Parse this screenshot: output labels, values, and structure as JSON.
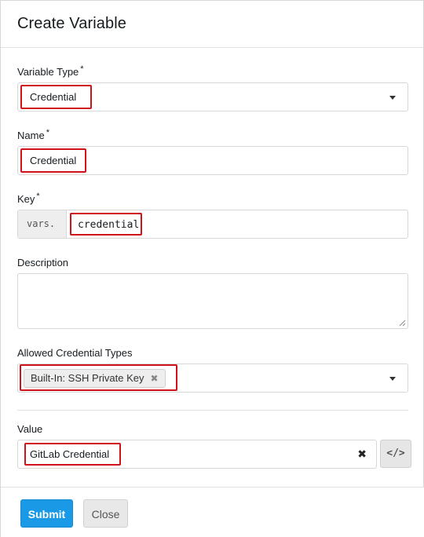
{
  "modal": {
    "title": "Create Variable"
  },
  "form": {
    "variable_type": {
      "label": "Variable Type",
      "required_mark": "*",
      "selected": "Credential"
    },
    "name": {
      "label": "Name",
      "required_mark": "*",
      "value": "Credential"
    },
    "key": {
      "label": "Key",
      "required_mark": "*",
      "prefix": "vars.",
      "value": "credential"
    },
    "description": {
      "label": "Description",
      "value": ""
    },
    "allowed_credential_types": {
      "label": "Allowed Credential Types",
      "chips": [
        {
          "label": "Built-In: SSH Private Key",
          "remove_glyph": "✖"
        }
      ]
    },
    "value": {
      "label": "Value",
      "value": "GitLab Credential",
      "clear_glyph": "✖",
      "code_toggle_glyph": "</>"
    }
  },
  "footer": {
    "submit_label": "Submit",
    "close_label": "Close"
  },
  "colors": {
    "highlight": "#d0121b",
    "submit_bg": "#1a9ae6"
  }
}
